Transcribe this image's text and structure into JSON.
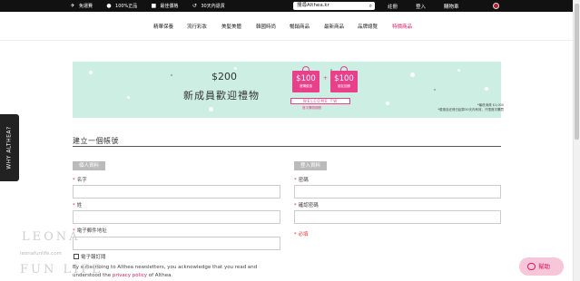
{
  "topbar": {
    "items": [
      {
        "icon": "airplane-icon",
        "label": "免運費"
      },
      {
        "icon": "check-badge-icon",
        "label": "100%正品"
      },
      {
        "icon": "price-tag-icon",
        "label": "最佳價格"
      },
      {
        "icon": "return-icon",
        "label": "30天內退貨"
      }
    ],
    "search_value": "搜尋Althea.kr",
    "links": [
      "註冊",
      "登入",
      "購物車"
    ]
  },
  "nav": {
    "items": [
      "精華保養",
      "流行彩妝",
      "美髮美體",
      "韓國時尚",
      "暢銷商品",
      "最新商品",
      "品牌總覽"
    ],
    "special": "特價商品"
  },
  "banner": {
    "amount": "$200",
    "title": "新成員歡迎禮物",
    "gift1_value": "$100",
    "gift1_text": "首購優惠",
    "gift2_value": "$100",
    "gift2_text": "朋友回饋",
    "welcome": "WELCOME TW",
    "first_order": "首次購物期間",
    "note1": "*最低消費 $1,000",
    "note2": "*優惠自註冊日起算30天內有效，只限首次購買"
  },
  "side_tab": "WHY ALTHEA?",
  "form": {
    "title": "建立一個帳號",
    "personal_tag": "個人資料",
    "login_tag": "登入資料",
    "first_name": "名字",
    "last_name": "姓",
    "email": "電子郵件地址",
    "subscribe": "電子報訂閱",
    "password": "密碼",
    "confirm_password": "確認密碼",
    "required_note": "* 必填",
    "terms_prefix": "By subscribing to Althea newsletters, you acknowledge that you read and understood the ",
    "terms_link": "privacy policy",
    "terms_suffix": " of Althea."
  },
  "watermark": {
    "line1": "LEONA",
    "line2": "leonafunlife.com",
    "line3": "FUN LIFE"
  },
  "help": {
    "label": "幫助"
  },
  "colors": {
    "accent": "#d81b60",
    "banner_bg": "#cdeee3",
    "gift": "#e8408a",
    "topbar": "#111111"
  }
}
